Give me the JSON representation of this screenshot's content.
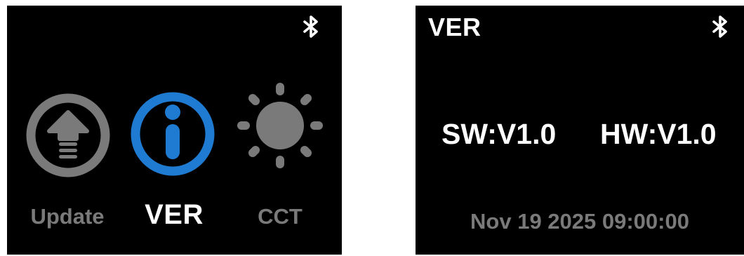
{
  "menu_screen": {
    "items": [
      {
        "label": "Update",
        "icon": "upload-arrow-icon",
        "state": "inactive"
      },
      {
        "label": "VER",
        "icon": "info-icon",
        "state": "selected"
      },
      {
        "label": "CCT",
        "icon": "sun-brightness-icon",
        "state": "inactive"
      }
    ],
    "status_icon": "bluetooth-icon"
  },
  "version_screen": {
    "title": "VER",
    "status_icon": "bluetooth-icon",
    "software_version": "SW:V1.0",
    "hardware_version": "HW:V1.0",
    "build_date": "Nov 19 2025 09:00:00"
  },
  "colors": {
    "screen_background": "#000000",
    "selected_accent": "#1f7bd1",
    "inactive": "#7a7a7a",
    "text": "#ffffff"
  }
}
